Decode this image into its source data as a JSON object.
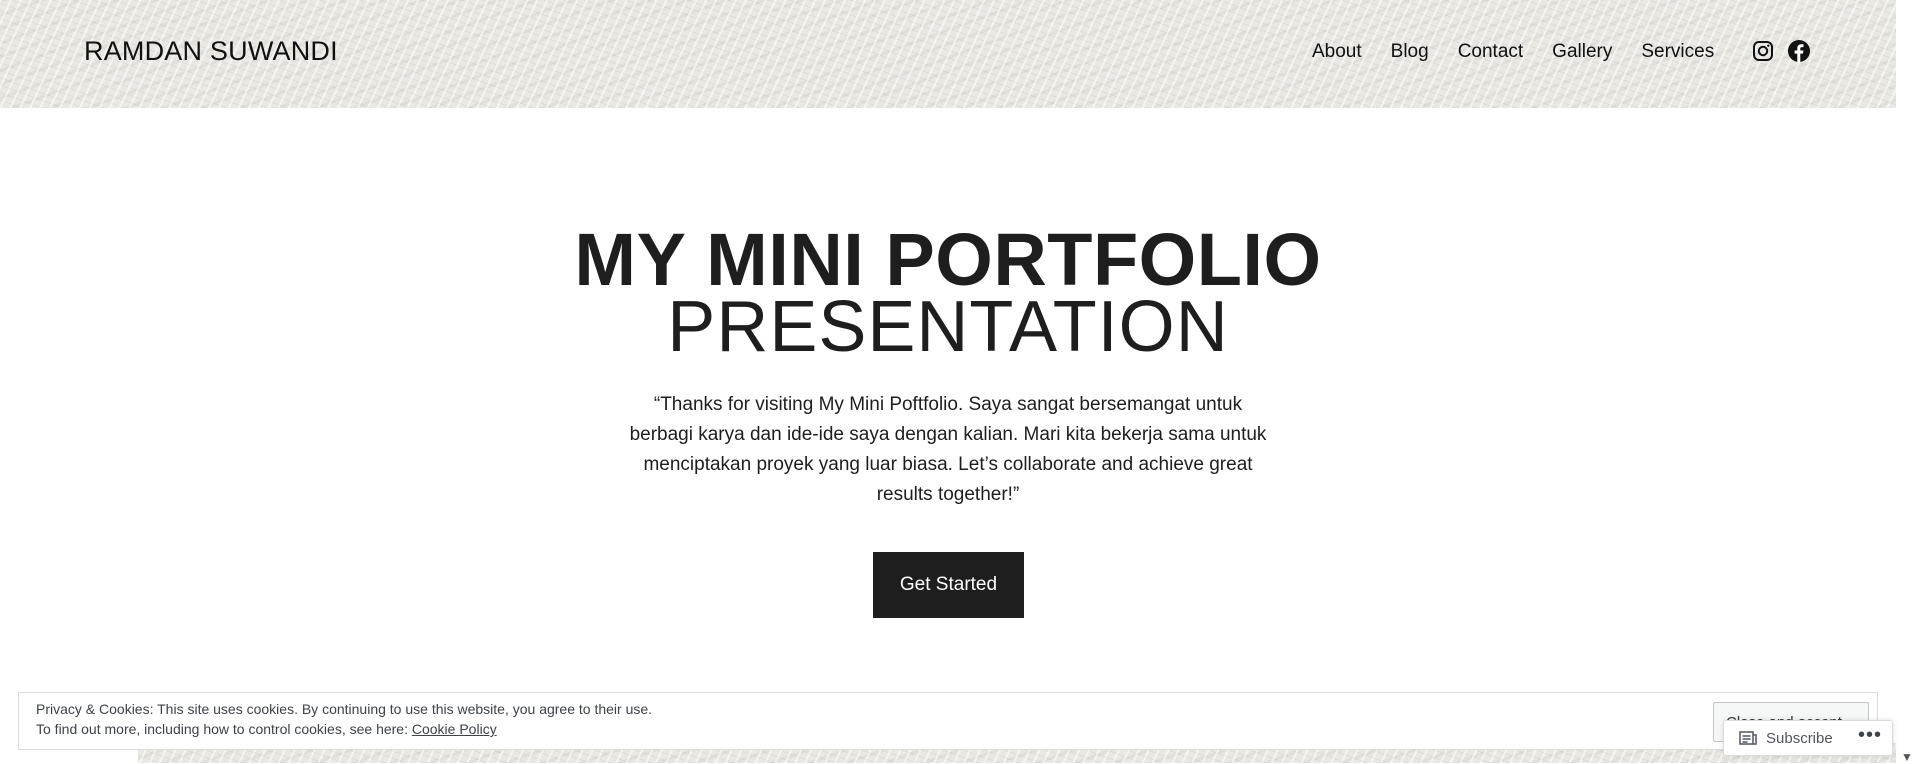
{
  "header": {
    "site_title": "RAMDAN SUWANDI",
    "nav": [
      "About",
      "Blog",
      "Contact",
      "Gallery",
      "Services"
    ],
    "social_icons": [
      "instagram-icon",
      "facebook-icon"
    ]
  },
  "hero": {
    "title_line1": "MY MINI PORTFOLIO",
    "title_line2": "PRESENTATION",
    "quote": "“Thanks for visiting My Mini Poftfolio. Saya sangat bersemangat untuk berbagi karya dan ide-ide saya dengan kalian. Mari kita bekerja sama untuk menciptakan proyek yang luar biasa. Let’s collaborate and achieve great results together!”",
    "cta_label": "Get Started"
  },
  "cookie_banner": {
    "line1": "Privacy & Cookies: This site uses cookies. By continuing to use this website, you agree to their use.",
    "line2_prefix": "To find out more, including how to control cookies, see here:",
    "policy_link": "Cookie Policy",
    "accept_label": "Close and accept"
  },
  "subscribe_bar": {
    "subscribe_label": "Subscribe",
    "more_label": "•••"
  },
  "colors": {
    "text": "#1e1e1e",
    "button_bg": "#1e1e1e",
    "header_texture": "#e9e8e3"
  }
}
